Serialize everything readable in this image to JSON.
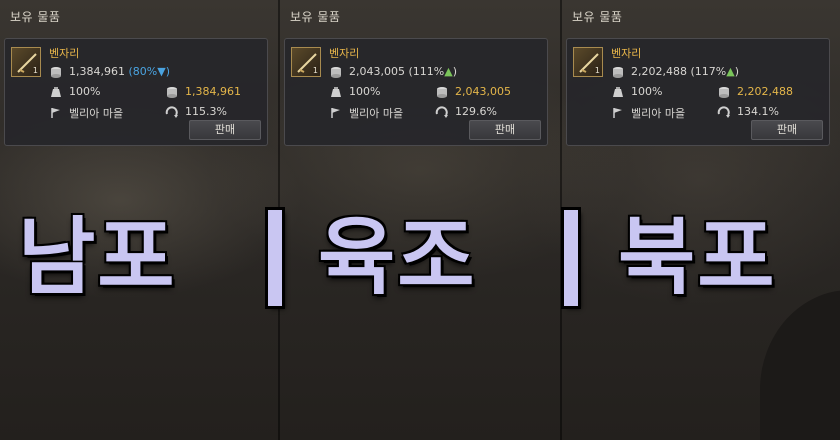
{
  "panels": [
    {
      "title": "보유 물품",
      "item_name": "벤자리",
      "item_count": "1",
      "price": "1,384,961",
      "price_pct": "80%",
      "price_trend": "▼",
      "durability": "100%",
      "sell_price": "1,384,961",
      "region": "벨리아 마을",
      "distance_bonus": "115.3%",
      "sell_label": "판매"
    },
    {
      "title": "보유 물품",
      "item_name": "벤자리",
      "item_count": "1",
      "price": "2,043,005",
      "price_pct": "111%",
      "price_trend": "▲",
      "durability": "100%",
      "sell_price": "2,043,005",
      "region": "벨리아 마을",
      "distance_bonus": "129.6%",
      "sell_label": "판매"
    },
    {
      "title": "보유 물품",
      "item_name": "벤자리",
      "item_count": "1",
      "price": "2,202,488",
      "price_pct": "117%",
      "price_trend": "▲",
      "durability": "100%",
      "sell_price": "2,202,488",
      "region": "벨리아 마을",
      "distance_bonus": "134.1%",
      "sell_label": "판매"
    }
  ],
  "overlay": {
    "left": "남포",
    "middle": "육조",
    "right": "북포"
  },
  "colors": {
    "gold_text": "#e4b64a",
    "trend_down": "#4aa3e0",
    "trend_up": "#7ac45a",
    "overlay_text": "#c9c6f2"
  },
  "icons": [
    "coin-stack-icon",
    "pouch-icon",
    "silver-stack-icon",
    "flag-icon",
    "refresh-arrow-icon",
    "fishing-rod-icon"
  ]
}
